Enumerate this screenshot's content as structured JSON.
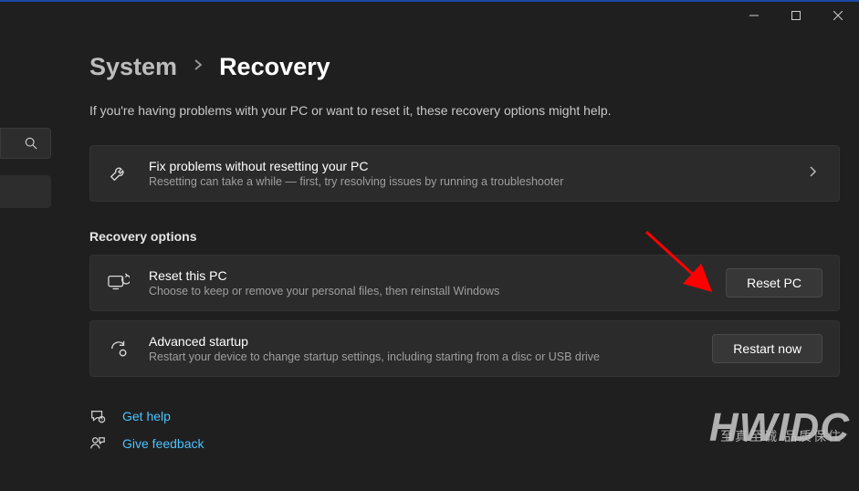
{
  "breadcrumb": {
    "parent": "System",
    "current": "Recovery"
  },
  "intro": "If you're having problems with your PC or want to reset it, these recovery options might help.",
  "troubleshoot_card": {
    "title": "Fix problems without resetting your PC",
    "subtitle": "Resetting can take a while — first, try resolving issues by running a troubleshooter"
  },
  "section_header": "Recovery options",
  "reset_card": {
    "title": "Reset this PC",
    "subtitle": "Choose to keep or remove your personal files, then reinstall Windows",
    "button": "Reset PC"
  },
  "advanced_card": {
    "title": "Advanced startup",
    "subtitle": "Restart your device to change startup settings, including starting from a disc or USB drive",
    "button": "Restart now"
  },
  "links": {
    "help": "Get help",
    "feedback": "Give feedback"
  },
  "watermark": {
    "big": "HWIDC",
    "small": "至真至诚  品质保住"
  }
}
